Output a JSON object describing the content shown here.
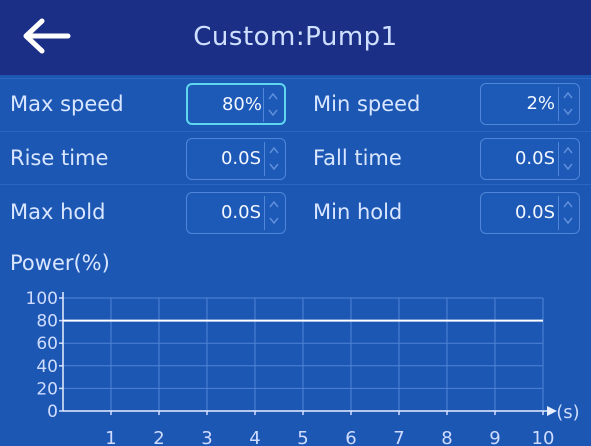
{
  "header": {
    "title": "Custom:Pump1",
    "back_icon": "back-arrow-icon"
  },
  "params": [
    {
      "label": "Max speed",
      "value": "80%",
      "active": true
    },
    {
      "label": "Min speed",
      "value": "2%",
      "active": false
    },
    {
      "label": "Rise time",
      "value": "0.0S",
      "active": false
    },
    {
      "label": "Fall time",
      "value": "0.0S",
      "active": false
    },
    {
      "label": "Max hold",
      "value": "0.0S",
      "active": false
    },
    {
      "label": "Min hold",
      "value": "0.0S",
      "active": false
    }
  ],
  "chart_data": {
    "type": "line",
    "title": "Power(%)",
    "xunit": "(s)",
    "xlim": [
      0,
      10
    ],
    "ylim": [
      0,
      100
    ],
    "x_ticks": [
      "1",
      "2",
      "3",
      "4",
      "5",
      "6",
      "7",
      "8",
      "9",
      "10"
    ],
    "y_ticks": [
      "100",
      "80",
      "60",
      "40",
      "20",
      "0"
    ],
    "series": [
      {
        "x": [
          0,
          10
        ],
        "values": [
          80,
          80
        ]
      }
    ],
    "grid": true
  },
  "colors": {
    "background": "#1c57b4",
    "titlebar": "#1c2f86",
    "grid": "#4f84d6",
    "line": "#ffffff",
    "active_border": "#5fd6ee"
  }
}
